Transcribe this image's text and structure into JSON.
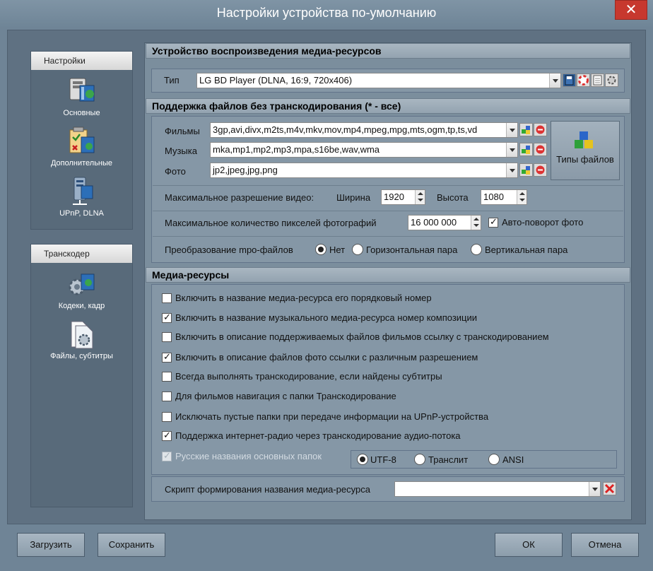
{
  "window": {
    "title": "Настройки устройства по-умолчанию",
    "close": "✕"
  },
  "nav": {
    "settings_header": "Настройки",
    "settings_items": [
      {
        "label": "Основные",
        "icon": "main-settings-icon"
      },
      {
        "label": "Дополнительные",
        "icon": "additional-settings-icon"
      },
      {
        "label": "UPnP, DLNA",
        "icon": "upnp-server-icon"
      }
    ],
    "transcoder_header": "Транскодер",
    "transcoder_items": [
      {
        "label": "Кодеки, кадр",
        "icon": "codecs-gear-icon"
      },
      {
        "label": "Файлы, субтитры",
        "icon": "files-gear-icon"
      }
    ]
  },
  "device": {
    "header": "Устройство воспроизведения медиа-ресурсов",
    "type_label": "Тип",
    "type_value": "LG BD Player (DLNA, 16:9, 720x406)"
  },
  "support": {
    "header": "Поддержка файлов без транскодирования (* - все)",
    "rows": [
      {
        "label": "Фильмы",
        "value": "3gp,avi,divx,m2ts,m4v,mkv,mov,mp4,mpeg,mpg,mts,ogm,tp,ts,vd"
      },
      {
        "label": "Музыка",
        "value": "mka,mp1,mp2,mp3,mpa,s16be,wav,wma"
      },
      {
        "label": "Фото",
        "value": "jp2,jpeg,jpg,png"
      }
    ],
    "file_types_button": "Типы файлов",
    "max_res_label": "Максимальное разрешение видео:",
    "width_label": "Ширина",
    "width_value": "1920",
    "height_label": "Высота",
    "height_value": "1080",
    "max_pixels_label": "Максимальное количество пикселей фотографий",
    "max_pixels_value": "16 000 000",
    "auto_rotate_label": "Авто-поворот фото",
    "auto_rotate_checked": true,
    "mpo_label": "Преобразование mpo-файлов",
    "mpo_options": [
      "Нет",
      "Горизонтальная пара",
      "Вертикальная пара"
    ],
    "mpo_selected": 0
  },
  "media": {
    "header": "Медиа-ресурсы",
    "options": [
      {
        "label": "Включить в название медиа-ресурса его порядковый номер",
        "checked": false
      },
      {
        "label": "Включить в название музыкального медиа-ресурса номер композиции",
        "checked": true
      },
      {
        "label": "Включить в описание поддерживаемых файлов фильмов ссылку с транскодированием",
        "checked": false
      },
      {
        "label": "Включить в описание файлов фото ссылки с различным разрешением",
        "checked": true
      },
      {
        "label": "Всегда выполнять транскодирование, если найдены субтитры",
        "checked": false
      },
      {
        "label": "Для фильмов навигация с папки Транскодирование",
        "checked": false
      },
      {
        "label": "Исключать пустые папки при передаче информации на  UPnP-устройства",
        "checked": false
      },
      {
        "label": "Поддержка интернет-радио через транскодирование аудио-потока",
        "checked": true
      }
    ],
    "russian_names_label": "Русские названия основных папок",
    "russian_names_checked": true,
    "encoding_options": [
      "UTF-8",
      "Транслит",
      "ANSI"
    ],
    "encoding_selected": 0,
    "script_label": "Скрипт формирования названия медиа-ресурса",
    "script_value": ""
  },
  "footer": {
    "load": "Загрузить",
    "save": "Сохранить",
    "ok": "ОК",
    "cancel": "Отмена"
  }
}
